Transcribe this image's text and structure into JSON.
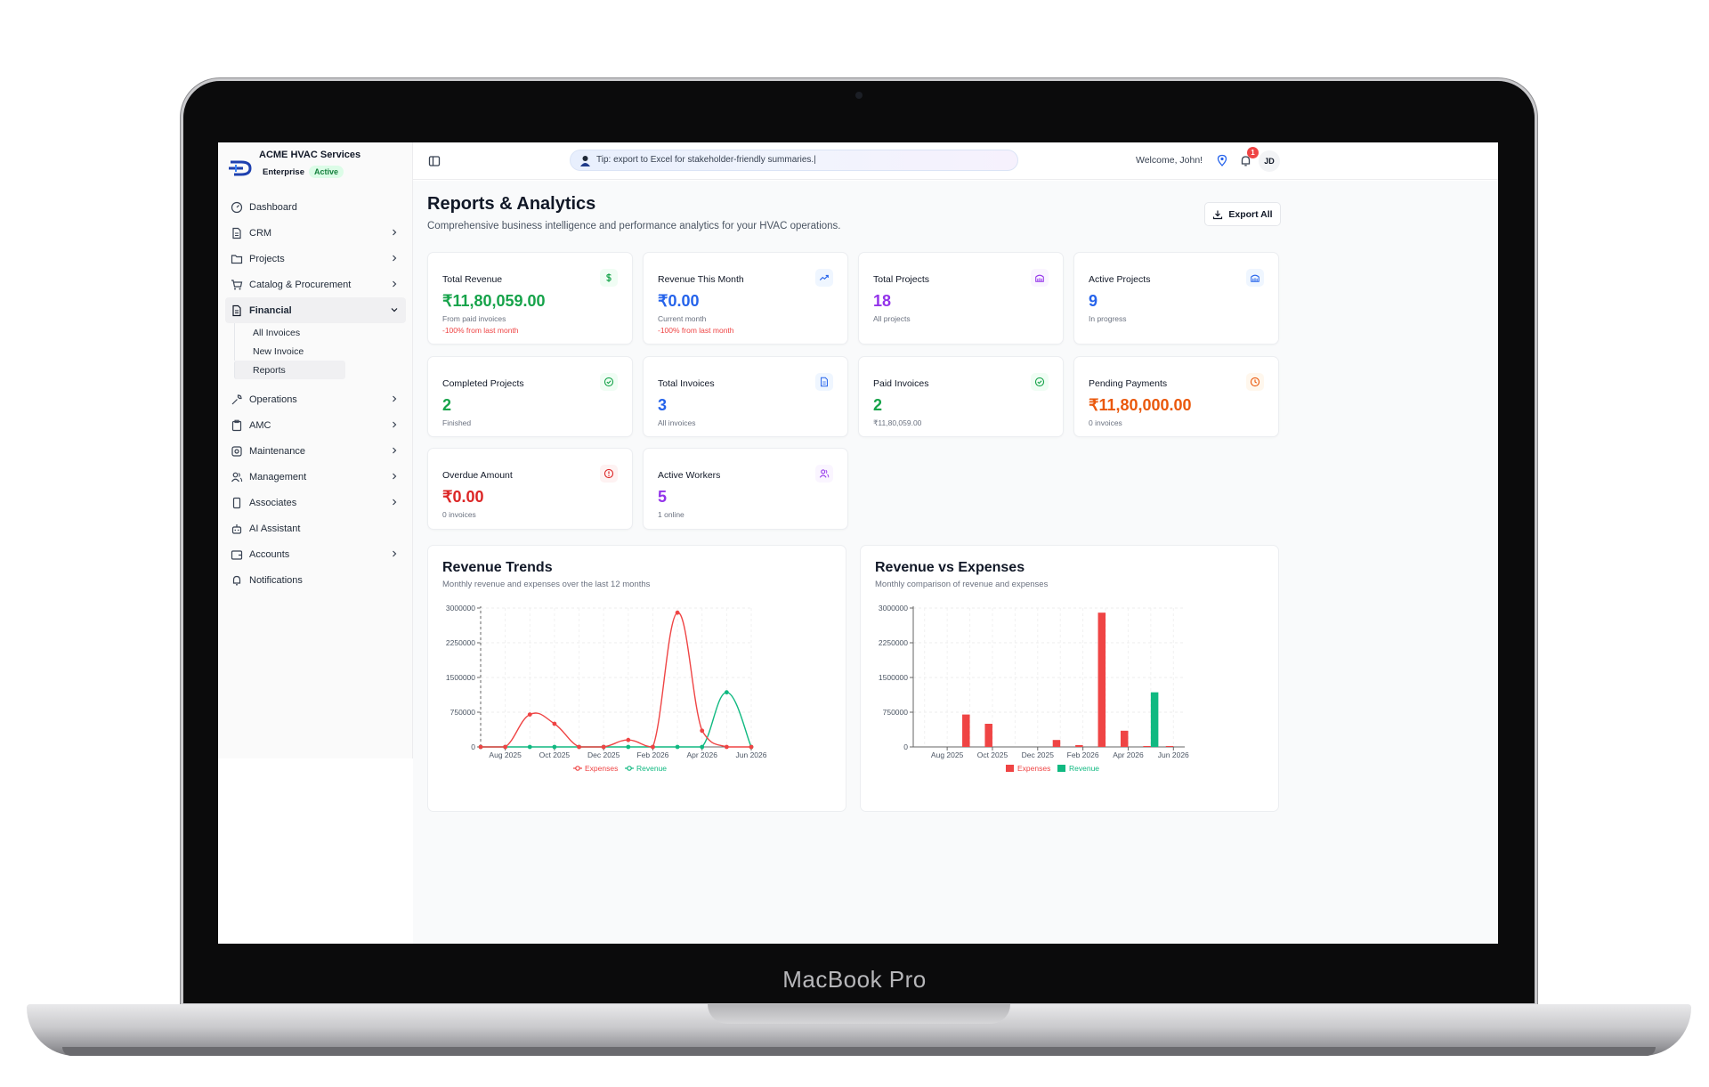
{
  "device": {
    "label": "MacBook Pro"
  },
  "brand": {
    "name": "ACME HVAC Services",
    "plan": "Enterprise",
    "status": "Active"
  },
  "sidebar": {
    "items": [
      {
        "label": "Dashboard",
        "icon": "gauge-icon",
        "has_chevron": false
      },
      {
        "label": "CRM",
        "icon": "file-icon",
        "has_chevron": true
      },
      {
        "label": "Projects",
        "icon": "folder-icon",
        "has_chevron": true
      },
      {
        "label": "Catalog & Procurement",
        "icon": "cart-icon",
        "has_chevron": true
      },
      {
        "label": "Financial",
        "icon": "document-icon",
        "has_chevron": true,
        "expanded": true
      },
      {
        "label": "Operations",
        "icon": "wrench-icon",
        "has_chevron": true
      },
      {
        "label": "AMC",
        "icon": "clipboard-icon",
        "has_chevron": true
      },
      {
        "label": "Maintenance",
        "icon": "cog-icon",
        "has_chevron": true
      },
      {
        "label": "Management",
        "icon": "users-icon",
        "has_chevron": true
      },
      {
        "label": "Associates",
        "icon": "phone-icon",
        "has_chevron": true
      },
      {
        "label": "AI Assistant",
        "icon": "bot-icon",
        "has_chevron": false
      },
      {
        "label": "Accounts",
        "icon": "wallet-icon",
        "has_chevron": true
      },
      {
        "label": "Notifications",
        "icon": "bell-icon",
        "has_chevron": false
      }
    ],
    "financial_sub": [
      "All Invoices",
      "New Invoice",
      "Reports"
    ]
  },
  "topbar": {
    "tip": "Tip: export to Excel for stakeholder-friendly summaries.|",
    "welcome": "Welcome, John!",
    "notification_count": "1",
    "avatar_initials": "JD"
  },
  "page": {
    "title": "Reports & Analytics",
    "subtitle": "Comprehensive business intelligence and performance analytics for your HVAC operations.",
    "export_label": "Export All"
  },
  "cards": [
    {
      "title": "Total Revenue",
      "value": "₹11,80,059.00",
      "note": "From paid invoices",
      "delta": "-100% from last month",
      "color": "#16a34a",
      "icon": "dollar-icon",
      "icon_bg": "#f0fdf4"
    },
    {
      "title": "Revenue This Month",
      "value": "₹0.00",
      "note": "Current month",
      "delta": "-100% from last month",
      "color": "#2563eb",
      "icon": "trending-up-icon",
      "icon_bg": "#eff6ff"
    },
    {
      "title": "Total Projects",
      "value": "18",
      "note": "All projects",
      "delta": "",
      "color": "#9333ea",
      "icon": "building-icon",
      "icon_bg": "#faf5ff"
    },
    {
      "title": "Active Projects",
      "value": "9",
      "note": "In progress",
      "delta": "",
      "color": "#2563eb",
      "icon": "building-icon",
      "icon_bg": "#eff6ff"
    },
    {
      "title": "Completed Projects",
      "value": "2",
      "note": "Finished",
      "delta": "",
      "color": "#16a34a",
      "icon": "check-circle-icon",
      "icon_bg": "#f0fdf4"
    },
    {
      "title": "Total Invoices",
      "value": "3",
      "note": "All invoices",
      "delta": "",
      "color": "#2563eb",
      "icon": "invoice-icon",
      "icon_bg": "#eff6ff"
    },
    {
      "title": "Paid Invoices",
      "value": "2",
      "note": "₹11,80,059.00",
      "delta": "",
      "color": "#16a34a",
      "icon": "check-circle-icon",
      "icon_bg": "#f0fdf4"
    },
    {
      "title": "Pending Payments",
      "value": "₹11,80,000.00",
      "note": "0 invoices",
      "delta": "",
      "color": "#ea580c",
      "icon": "clock-icon",
      "icon_bg": "#fff7ed"
    },
    {
      "title": "Overdue Amount",
      "value": "₹0.00",
      "note": "0 invoices",
      "delta": "",
      "color": "#dc2626",
      "icon": "alert-circle-icon",
      "icon_bg": "#fef2f2"
    },
    {
      "title": "Active Workers",
      "value": "5",
      "note": "1 online",
      "delta": "",
      "color": "#9333ea",
      "icon": "users-icon",
      "icon_bg": "#faf5ff"
    }
  ],
  "colors": {
    "expenses": "#ef4444",
    "revenue": "#10b981"
  },
  "chart_data": [
    {
      "type": "line",
      "title": "Revenue Trends",
      "subtitle": "Monthly revenue and expenses over the last 12 months",
      "categories": [
        "Jul 2025",
        "Aug 2025",
        "Sep 2025",
        "Oct 2025",
        "Nov 2025",
        "Dec 2025",
        "Jan 2026",
        "Feb 2026",
        "Mar 2026",
        "Apr 2026",
        "May 2026",
        "Jun 2026"
      ],
      "tick_labels": [
        "Aug 2025",
        "Oct 2025",
        "Dec 2025",
        "Feb 2026",
        "Apr 2026",
        "Jun 2026"
      ],
      "series": [
        {
          "name": "Expenses",
          "values": [
            0,
            0,
            700000,
            500000,
            0,
            0,
            150000,
            0,
            2900000,
            350000,
            0,
            0
          ]
        },
        {
          "name": "Revenue",
          "values": [
            0,
            0,
            0,
            0,
            0,
            0,
            0,
            0,
            0,
            0,
            1180000,
            0
          ]
        }
      ],
      "y_ticks": [
        0,
        750000,
        1500000,
        2250000,
        3000000
      ],
      "ylim": [
        0,
        3000000
      ],
      "grid": true,
      "legend": "bottom"
    },
    {
      "type": "bar",
      "title": "Revenue vs Expenses",
      "subtitle": "Monthly comparison of revenue and expenses",
      "categories": [
        "Jul 2025",
        "Aug 2025",
        "Sep 2025",
        "Oct 2025",
        "Nov 2025",
        "Dec 2025",
        "Jan 2026",
        "Feb 2026",
        "Mar 2026",
        "Apr 2026",
        "May 2026",
        "Jun 2026"
      ],
      "tick_labels": [
        "Aug 2025",
        "Oct 2025",
        "Dec 2025",
        "Feb 2026",
        "Apr 2026",
        "Jun 2026"
      ],
      "series": [
        {
          "name": "Expenses",
          "values": [
            0,
            0,
            700000,
            500000,
            0,
            0,
            150000,
            40000,
            2900000,
            350000,
            20000,
            20000
          ]
        },
        {
          "name": "Revenue",
          "values": [
            0,
            0,
            0,
            0,
            0,
            0,
            0,
            0,
            0,
            0,
            1180000,
            0
          ]
        }
      ],
      "y_ticks": [
        0,
        750000,
        1500000,
        2250000,
        3000000
      ],
      "ylim": [
        0,
        3000000
      ],
      "grid": true,
      "legend": "bottom"
    }
  ]
}
